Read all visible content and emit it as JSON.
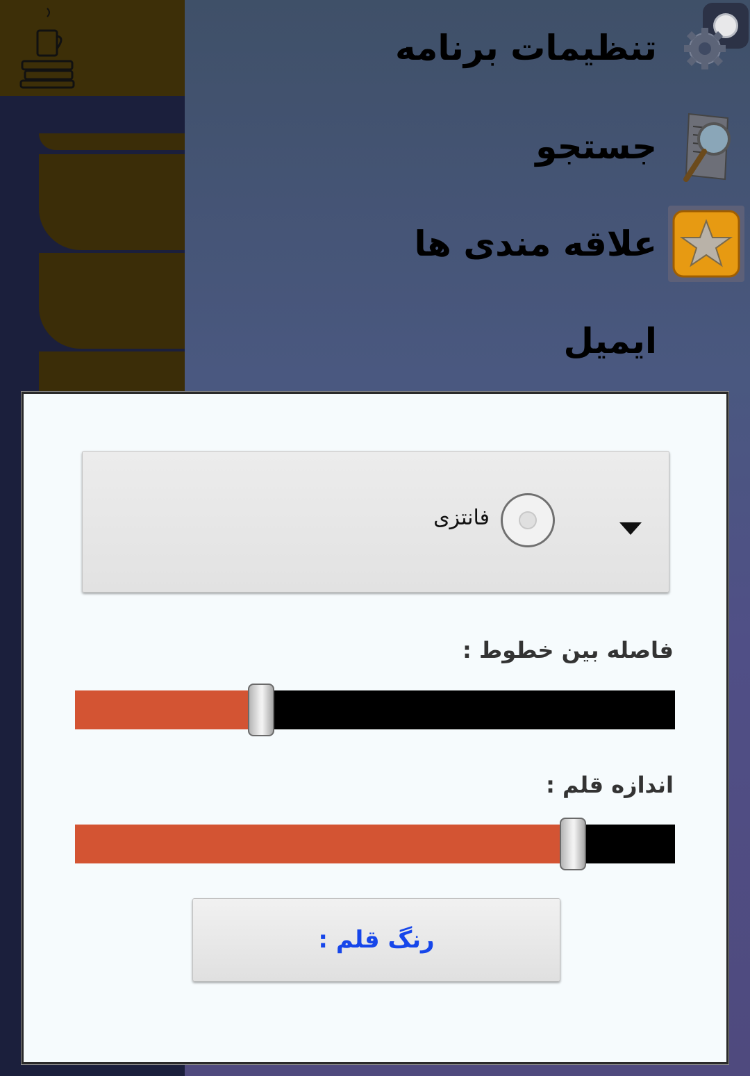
{
  "menu": {
    "items": [
      {
        "label": "تنظیمات برنامه",
        "icon": "gear-icon"
      },
      {
        "label": "جستجو",
        "icon": "search-document-icon"
      },
      {
        "label": "علاقه مندی ها",
        "icon": "star-icon"
      },
      {
        "label": "ایمیل",
        "icon": ""
      }
    ]
  },
  "dialog": {
    "font_select": {
      "selected": "فانتزی"
    },
    "line_spacing": {
      "label": "فاصله بین خطوط :",
      "value_fraction": 0.31
    },
    "font_size": {
      "label": "اندازه قلم :",
      "value_fraction": 0.83
    },
    "color_button": {
      "label": "رنگ قلم :"
    }
  },
  "colors": {
    "slider_fill": "#d35433",
    "slider_track": "#000000",
    "color_button_text": "#1646ea",
    "star_tile": "#e79a12"
  }
}
